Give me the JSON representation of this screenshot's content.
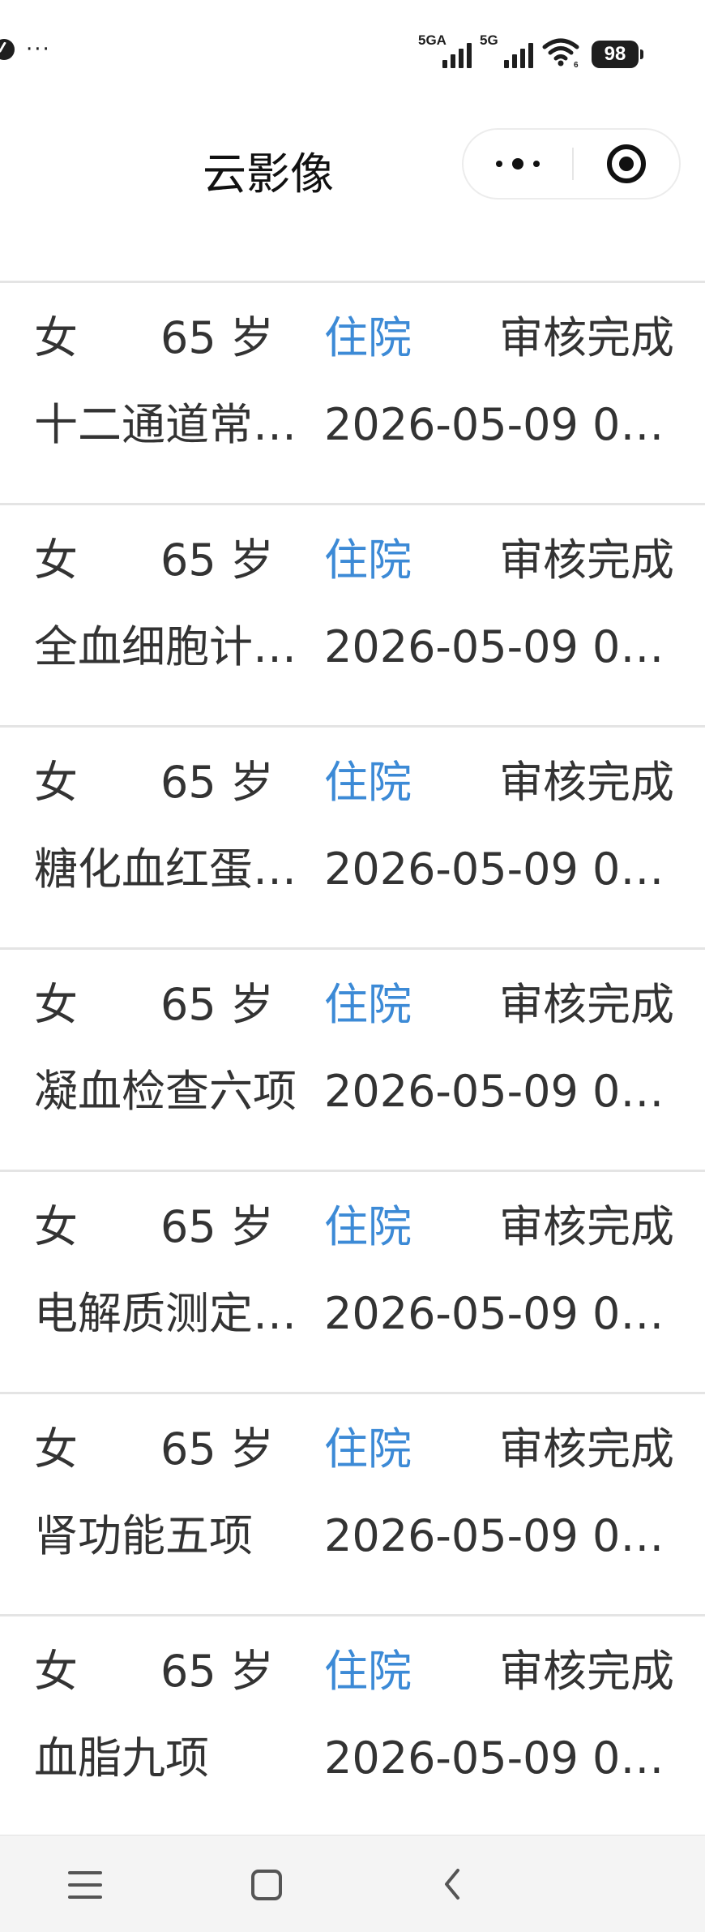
{
  "status_bar": {
    "more": "···",
    "signal_1_label": "5GA",
    "signal_2_label": "5G",
    "battery_level": "98"
  },
  "nav": {
    "title": "云影像",
    "capsule_more_icon": "more-dots-icon",
    "capsule_close_icon": "target-circle-icon"
  },
  "records": [
    {
      "gender": "女",
      "age": "65 岁",
      "type": "住院",
      "status": "审核完成",
      "item": "十二通道常…",
      "date": "2026-05-09 0…"
    },
    {
      "gender": "女",
      "age": "65 岁",
      "type": "住院",
      "status": "审核完成",
      "item": "全血细胞计…",
      "date": "2026-05-09 0…"
    },
    {
      "gender": "女",
      "age": "65 岁",
      "type": "住院",
      "status": "审核完成",
      "item": "糖化血红蛋…",
      "date": "2026-05-09 0…"
    },
    {
      "gender": "女",
      "age": "65 岁",
      "type": "住院",
      "status": "审核完成",
      "item": "凝血检查六项",
      "date": "2026-05-09 0…"
    },
    {
      "gender": "女",
      "age": "65 岁",
      "type": "住院",
      "status": "审核完成",
      "item": "电解质测定…",
      "date": "2026-05-09 0…"
    },
    {
      "gender": "女",
      "age": "65 岁",
      "type": "住院",
      "status": "审核完成",
      "item": "肾功能五项",
      "date": "2026-05-09 0…"
    },
    {
      "gender": "女",
      "age": "65 岁",
      "type": "住院",
      "status": "审核完成",
      "item": "血脂九项",
      "date": "2026-05-09 0…"
    }
  ],
  "colors": {
    "accent_type": "#3c8ad6",
    "text": "#333333",
    "divider": "#e4e4e4",
    "system_nav_bg": "#f4f4f4"
  },
  "system_nav": {
    "menu_icon": "menu-icon",
    "home_icon": "home-square-icon",
    "back_icon": "back-chevron-icon"
  }
}
